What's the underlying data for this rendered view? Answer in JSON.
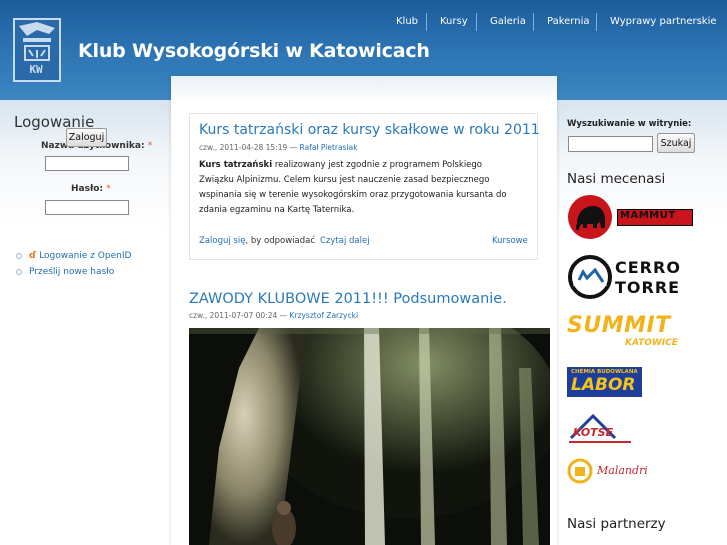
{
  "site": {
    "name": "Klub Wysokogórski w Katowicach",
    "logo_text": "KW"
  },
  "nav": {
    "items": [
      "Klub",
      "Kursy",
      "Galeria",
      "Pakernia",
      "Wyprawy partnerskie"
    ]
  },
  "login": {
    "title": "Logowanie",
    "username_label": "Nazwa użytkownika:",
    "password_label": "Hasło:",
    "required_mark": "*",
    "submit_label": "Zaloguj",
    "links": [
      "Logowanie z OpenID",
      "Prześlij nowe hasło"
    ],
    "openid_mark": "ɗ"
  },
  "nodes": [
    {
      "title": "Kurs tatrzański oraz kursy skałkowe w roku 2011",
      "date": "czw., 2011-04-28 15:19",
      "dash": "—",
      "author": "Rafał Pietrasiak",
      "body_bold": "Kurs tatrzański",
      "body_text": " realizowany jest zgodnie z programem Polskiego Związku Alpinizmu. Celem kursu jest nauczenie zasad bezpiecznego wspinania się w terenie wysokogórskim oraz przygotowania kursanta do zdania egzaminu na Kartę Taternika.",
      "login_link": "Zaloguj się",
      "login_suffix": ", by odpowiadać",
      "read_more": "Czytaj dalej",
      "tag": "Kursowe"
    },
    {
      "title": "ZAWODY KLUBOWE 2011!!! Podsumowanie.",
      "date": "czw., 2011-07-07 00:24",
      "dash": "—",
      "author": "Krzysztof Zarzycki"
    }
  ],
  "search": {
    "label": "Wyszukiwanie w witrynie:",
    "button": "Szukaj"
  },
  "sponsors": {
    "title": "Nasi mecenasi",
    "logos": [
      "MAMMUT",
      "CERRO",
      "TORRE",
      "SUMMIT",
      "KATOWICE",
      "CHEMIA BUDOWLANA",
      "LABOR",
      "KOTSE",
      "Malandri"
    ]
  },
  "partners": {
    "title": "Nasi partnerzy"
  },
  "colors": {
    "header": "#2e76b4",
    "link": "#1f6fb3",
    "title_link": "#2a7ab8",
    "summit": "#f3b21b",
    "labor": "#1f3d9a",
    "kotse": "#c7282a"
  }
}
